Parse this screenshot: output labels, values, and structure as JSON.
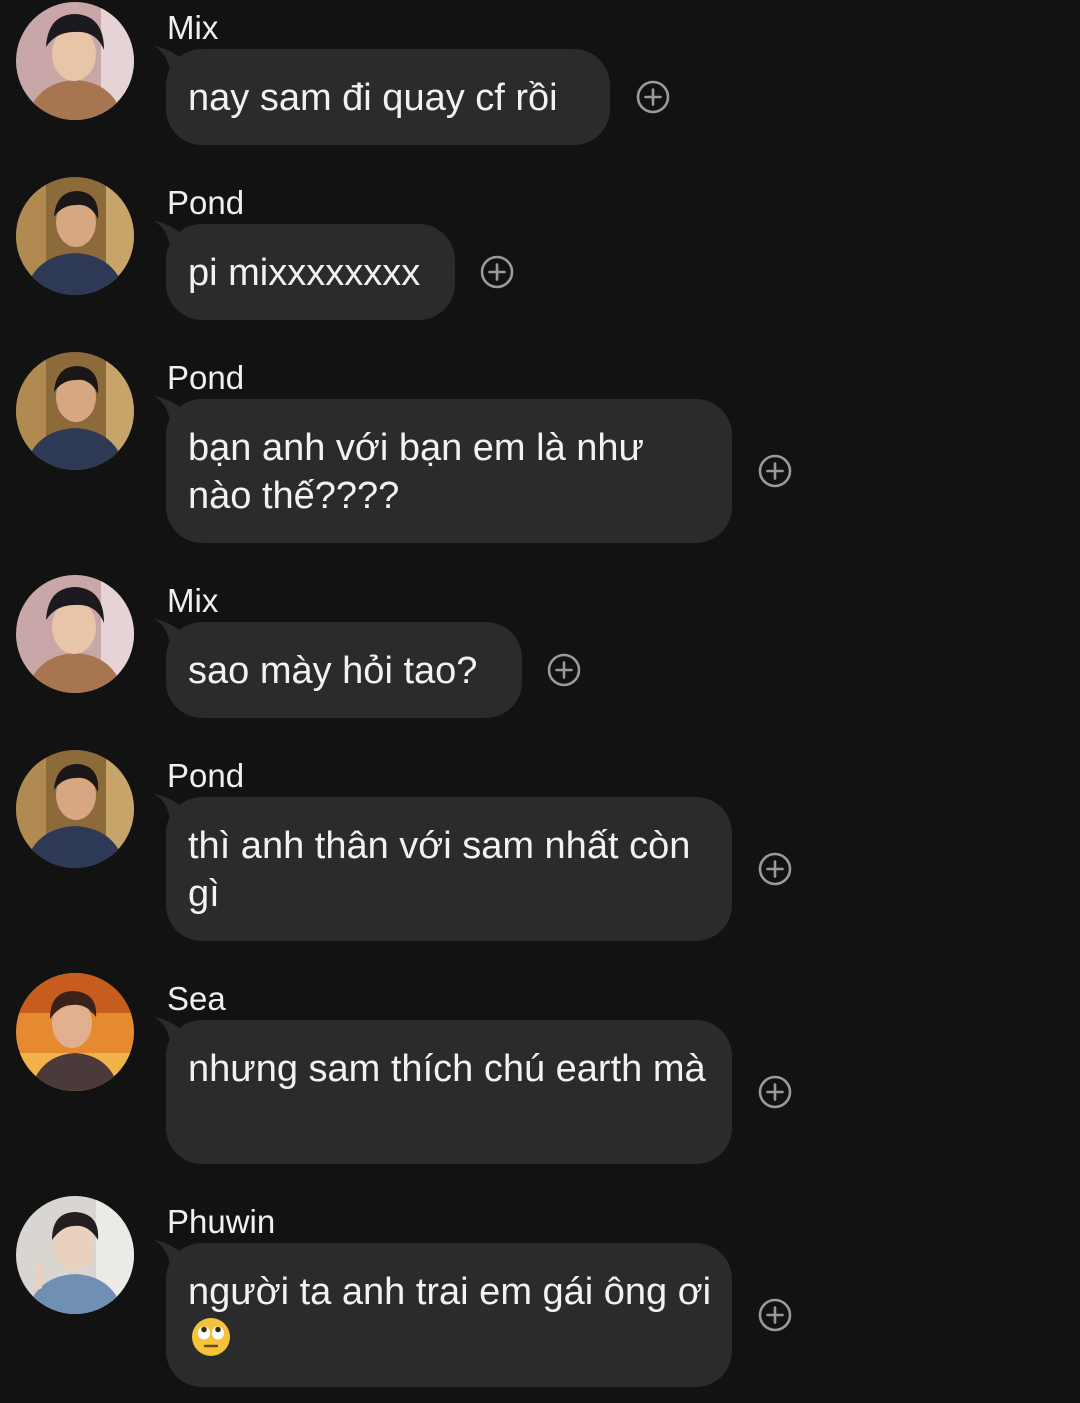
{
  "messages": [
    {
      "sender": "Mix",
      "text": "nay sam đi quay cf rồi",
      "avatar_icon": "mix-avatar-icon"
    },
    {
      "sender": "Pond",
      "text": "pi mixxxxxxxx",
      "avatar_icon": "pond-avatar-icon"
    },
    {
      "sender": "Pond",
      "text": "bạn anh với bạn em là như nào thế????",
      "avatar_icon": "pond-avatar-icon"
    },
    {
      "sender": "Mix",
      "text": "sao mày hỏi tao?",
      "avatar_icon": "mix-avatar-icon"
    },
    {
      "sender": "Pond",
      "text": "thì anh thân với sam nhất còn gì",
      "avatar_icon": "pond-avatar-icon"
    },
    {
      "sender": "Sea",
      "text": "nhưng sam thích chú earth mà",
      "avatar_icon": "sea-avatar-icon"
    },
    {
      "sender": "Phuwin",
      "text": "người ta anh trai em gái ông ơi",
      "emoji_icon": "face-with-rolling-eyes-icon",
      "avatar_icon": "phuwin-avatar-icon"
    }
  ],
  "icons": {
    "react": "add-reaction-icon"
  },
  "colors": {
    "background": "#121212",
    "bubble": "#2b2b2b",
    "text": "#f2f2f2",
    "react_icon": "#9a9a9a"
  }
}
